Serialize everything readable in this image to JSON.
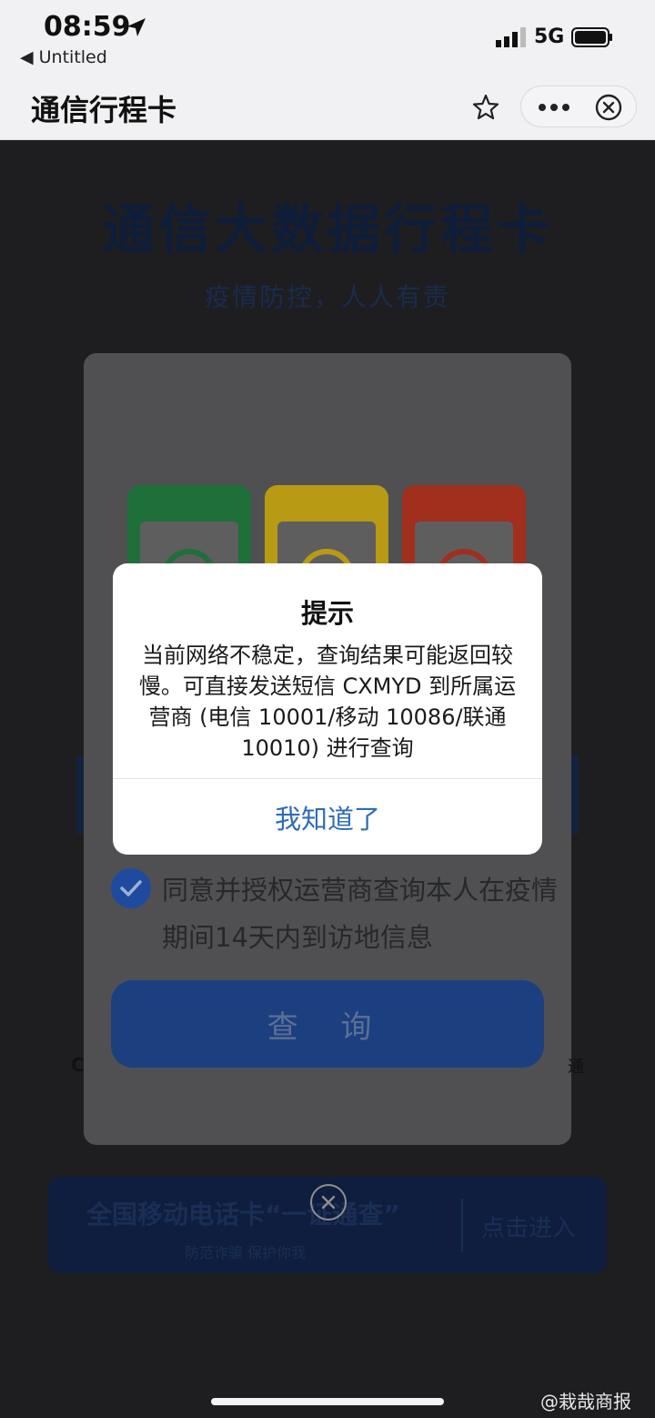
{
  "status_bar": {
    "time": "08:59",
    "back_app": "◀ Untitled",
    "network": "5G"
  },
  "header": {
    "title": "通信行程卡"
  },
  "page": {
    "hero_title": "通信大数据行程卡",
    "hero_subtitle": "疫情防控，人人有责",
    "agree_text": "同意并授权运营商查询本人在疫情期间14天内到访地信息",
    "query_button": "查 询",
    "card_colors": [
      "#1f6f3a",
      "#b89a14",
      "#a02f1e"
    ]
  },
  "banner": {
    "title": "全国移动电话卡“一证通查”",
    "subtitle": "防范诈骗 保护你我",
    "enter": "点击进入"
  },
  "dialog": {
    "title": "提示",
    "message": "当前网络不稳定，查询结果可能返回较慢。可直接发送短信 CXMYD 到所属运营商 (电信 10001/移动 10086/联通 10010) 进行查询",
    "ok_button": "我知道了"
  },
  "watermark": "@栽哉商报"
}
